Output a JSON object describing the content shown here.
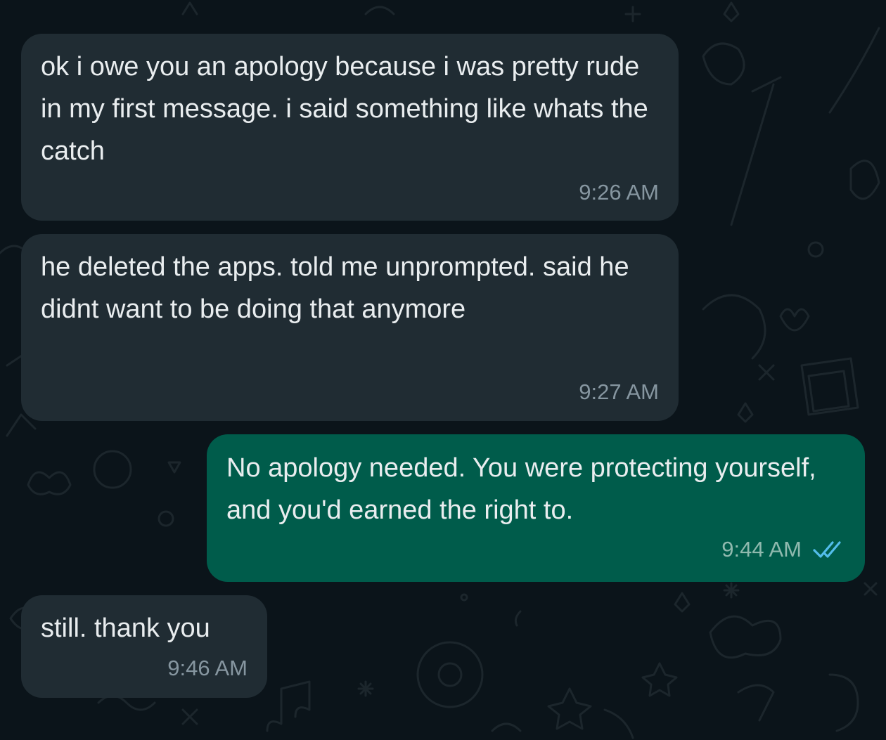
{
  "colors": {
    "background": "#0b141a",
    "incoming_bubble": "#202c33",
    "outgoing_bubble": "#005c4b",
    "text": "#e9edef",
    "time_incoming": "#8696a0",
    "time_outgoing": "#8fb9ae",
    "read_ticks": "#53bdeb"
  },
  "messages": [
    {
      "direction": "incoming",
      "text": "ok i owe you an apology because i was pretty rude in my first message. i said something like whats the catch",
      "time": "9:26 AM"
    },
    {
      "direction": "incoming",
      "text": "he deleted the apps. told me unprompted. said he didnt want to be doing that anymore",
      "time": "9:27 AM"
    },
    {
      "direction": "outgoing",
      "text": "No apology needed. You were protecting yourself, and you'd earned the right to.",
      "time": "9:44 AM",
      "status_icon": "double-check-read-icon"
    },
    {
      "direction": "incoming",
      "text": "still. thank you",
      "time": "9:46 AM"
    }
  ]
}
